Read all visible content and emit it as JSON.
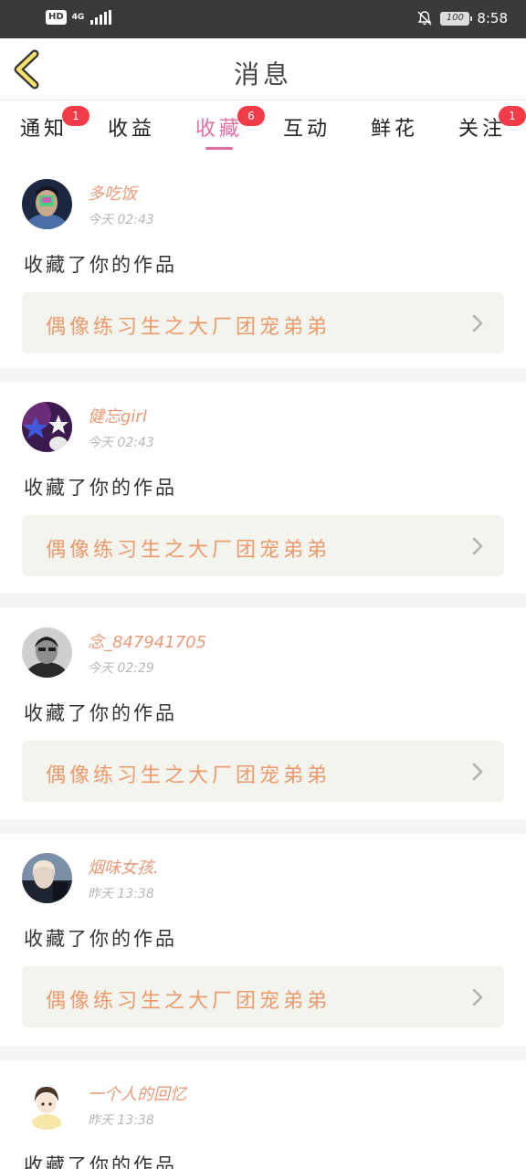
{
  "status_bar": {
    "hd": "HD",
    "network": "4G",
    "battery": "100",
    "time": "8:58",
    "icons": [
      "signal-icon",
      "bell-muted-icon",
      "battery-icon"
    ]
  },
  "header": {
    "title": "消息",
    "back_icon": "chevron-left-icon"
  },
  "tabs": [
    {
      "label": "通知",
      "badge": "1"
    },
    {
      "label": "收益",
      "badge": null
    },
    {
      "label": "收藏",
      "badge": "6",
      "active": true
    },
    {
      "label": "互动",
      "badge": null
    },
    {
      "label": "鲜花",
      "badge": null
    },
    {
      "label": "关注",
      "badge": "1"
    }
  ],
  "colors": {
    "accent": "#e56fa3",
    "badge": "#f23b48",
    "username": "#e89a78",
    "work_title": "#ec9a6c",
    "work_bg": "#f4f4ee"
  },
  "messages": [
    {
      "user": "多吃饭",
      "time": "今天 02:43",
      "action": "收藏了你的作品",
      "work": "偶像练习生之大厂团宠弟弟"
    },
    {
      "user": "健忘girl",
      "time": "今天 02:43",
      "action": "收藏了你的作品",
      "work": "偶像练习生之大厂团宠弟弟"
    },
    {
      "user": "念_847941705",
      "time": "今天 02:29",
      "action": "收藏了你的作品",
      "work": "偶像练习生之大厂团宠弟弟"
    },
    {
      "user": "烟味女孩.",
      "time": "昨天 13:38",
      "action": "收藏了你的作品",
      "work": "偶像练习生之大厂团宠弟弟"
    },
    {
      "user": "一个人的回忆",
      "time": "昨天 13:38",
      "action": "收藏了你的作品",
      "work": ""
    }
  ]
}
